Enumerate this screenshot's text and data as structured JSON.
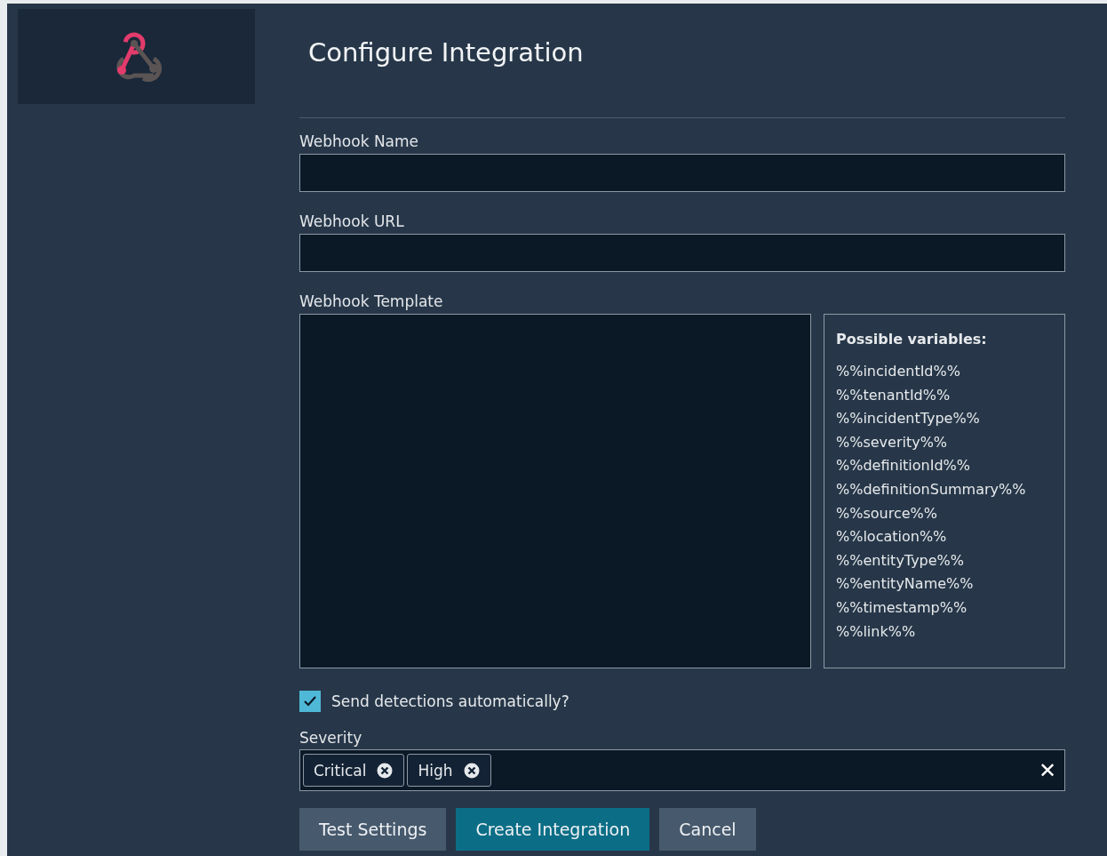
{
  "title": "Configure Integration",
  "fields": [
    {
      "label": "Webhook Name"
    },
    {
      "label": "Webhook URL"
    }
  ],
  "template": {
    "label": "Webhook Template",
    "variables_title": "Possible variables:",
    "variables": [
      "%%incidentId%%",
      "%%tenantId%%",
      "%%incidentType%%",
      "%%severity%%",
      "%%definitionId%%",
      "%%definitionSummary%%",
      "%%source%%",
      "%%location%%",
      "%%entityType%%",
      "%%entityName%%",
      "%%timestamp%%",
      "%%link%%"
    ]
  },
  "auto_send": {
    "label": "Send detections automatically?",
    "checked": true
  },
  "severity": {
    "label": "Severity",
    "tags": [
      "Critical",
      "High"
    ],
    "clear": "✕"
  },
  "buttons": [
    {
      "label": "Test Settings",
      "kind": "secondary"
    },
    {
      "label": "Create Integration",
      "kind": "primary"
    },
    {
      "label": "Cancel",
      "kind": "secondary"
    }
  ]
}
